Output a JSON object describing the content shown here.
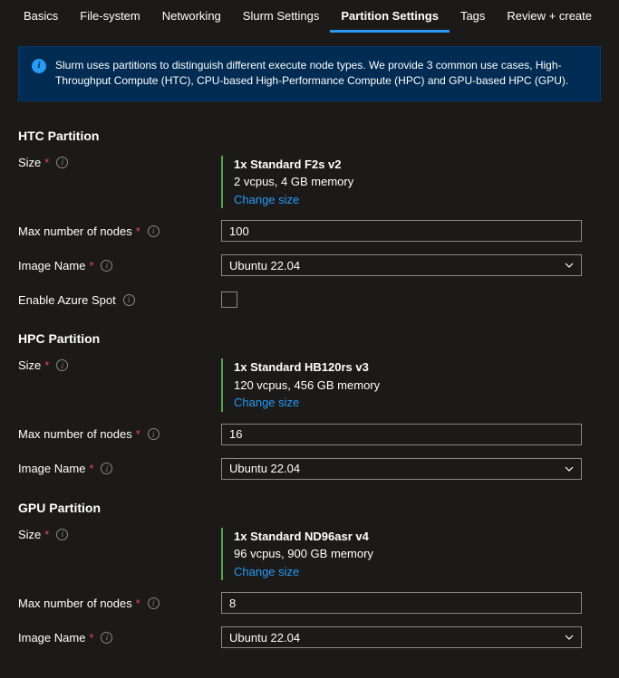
{
  "tabs": {
    "basics": "Basics",
    "filesystem": "File-system",
    "networking": "Networking",
    "slurm": "Slurm Settings",
    "partition": "Partition Settings",
    "tags": "Tags",
    "review": "Review + create"
  },
  "info": {
    "text": "Slurm uses partitions to distinguish different execute node types. We provide 3 common use cases, High-Throughput Compute (HTC), CPU-based High-Performance Compute (HPC) and GPU-based HPC (GPU)."
  },
  "labels": {
    "size": "Size",
    "maxNodes": "Max number of nodes",
    "imageName": "Image Name",
    "enableSpot": "Enable Azure Spot"
  },
  "link": {
    "change": "Change size"
  },
  "htc": {
    "title": "HTC Partition",
    "vm_title": "1x Standard F2s v2",
    "vm_sub": "2 vcpus, 4 GB memory",
    "max_nodes": "100",
    "image": "Ubuntu 22.04"
  },
  "hpc": {
    "title": "HPC Partition",
    "vm_title": "1x Standard HB120rs v3",
    "vm_sub": "120 vcpus, 456 GB memory",
    "max_nodes": "16",
    "image": "Ubuntu 22.04"
  },
  "gpu": {
    "title": "GPU Partition",
    "vm_title": "1x Standard ND96asr v4",
    "vm_sub": "96 vcpus, 900 GB memory",
    "max_nodes": "8",
    "image": "Ubuntu 22.04"
  }
}
